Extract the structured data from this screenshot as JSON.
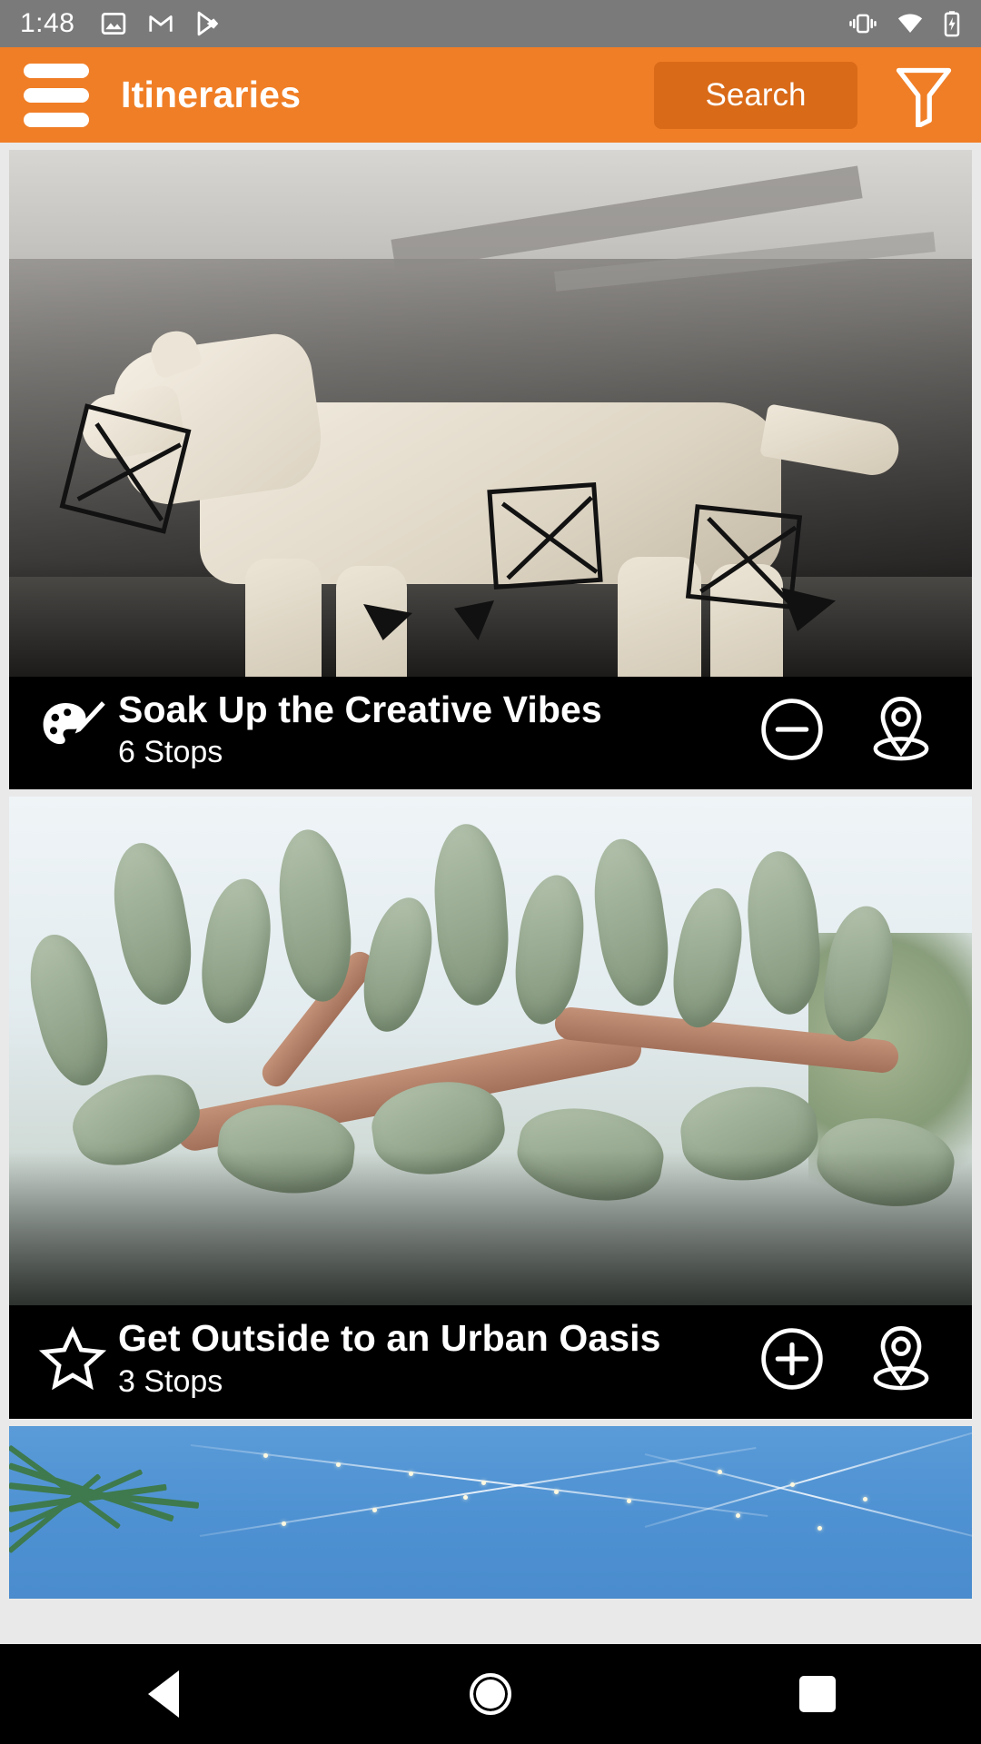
{
  "statusbar": {
    "time": "1:48",
    "left_icons": [
      "photos-icon",
      "gmail-icon",
      "play-store-icon"
    ],
    "right_icons": [
      "vibrate-icon",
      "wifi-icon",
      "battery-charging-icon"
    ],
    "background_color": "#7a7a7a"
  },
  "appbar": {
    "menu_icon": "hamburger-menu-icon",
    "title": "Itineraries",
    "search_label": "Search",
    "filter_icon": "funnel-filter-icon",
    "background_color": "#f07e26",
    "search_button_color": "#d96a18"
  },
  "cards": [
    {
      "category_icon": "art-palette-icon",
      "title": "Soak Up the Creative Vibes",
      "stops": "6 Stops",
      "action_icon": "minus-circle-icon",
      "map_icon": "map-pin-icon",
      "photo": "gallery-sculpture-photo"
    },
    {
      "category_icon": "star-outline-icon",
      "title": "Get Outside to an Urban Oasis",
      "stops": "3 Stops",
      "action_icon": "plus-circle-icon",
      "map_icon": "map-pin-icon",
      "photo": "cactus-garden-photo"
    },
    {
      "category_icon": "",
      "title": "",
      "stops": "",
      "action_icon": "",
      "map_icon": "",
      "photo": "palm-string-lights-photo"
    }
  ],
  "navbar": {
    "back": "back-triangle-icon",
    "home": "home-circle-icon",
    "recent": "recent-apps-square-icon"
  }
}
